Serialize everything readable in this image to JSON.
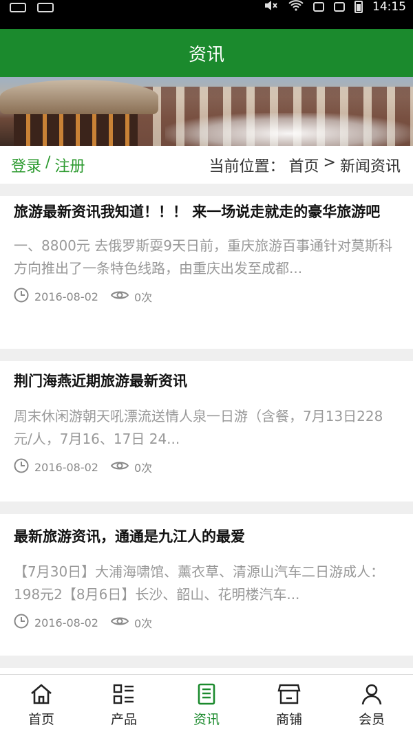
{
  "status": {
    "time": "14:15"
  },
  "header": {
    "title": "资讯"
  },
  "crumb": {
    "login": "登录",
    "sep": "/",
    "register": "注册",
    "location_label": "当前位置：",
    "home": "首页",
    "arrow": ">",
    "current": "新闻资讯"
  },
  "articles": [
    {
      "title": "旅游最新资讯我知道！！！ 来一场说走就走的豪华旅游吧",
      "summary": "一、8800元 去俄罗斯耍9天日前，重庆旅游百事通针对莫斯科方向推出了一条特色线路，由重庆出发至成都...",
      "date": "2016-08-02",
      "views": "0次"
    },
    {
      "title": "荆门海燕近期旅游最新资讯",
      "summary": "周末休闲游朝天吼漂流送情人泉一日游（含餐，7月13日228元/人，7月16、17日  24...",
      "date": "2016-08-02",
      "views": "0次"
    },
    {
      "title": "最新旅游资讯，通通是九江人的最爱",
      "summary": "【7月30日】大浦海啸馆、薰衣草、清源山汽车二日游成人：198元2【8月6日】长沙、韶山、花明楼汽车...",
      "date": "2016-08-02",
      "views": "0次"
    }
  ],
  "tabs": [
    {
      "label": "首页",
      "icon": "home-icon"
    },
    {
      "label": "产品",
      "icon": "grid-list-icon"
    },
    {
      "label": "资讯",
      "icon": "document-icon"
    },
    {
      "label": "商铺",
      "icon": "store-icon"
    },
    {
      "label": "会员",
      "icon": "user-icon"
    }
  ],
  "colors": {
    "brand": "#1b8a2d",
    "accent_text": "#2c9a2f"
  }
}
